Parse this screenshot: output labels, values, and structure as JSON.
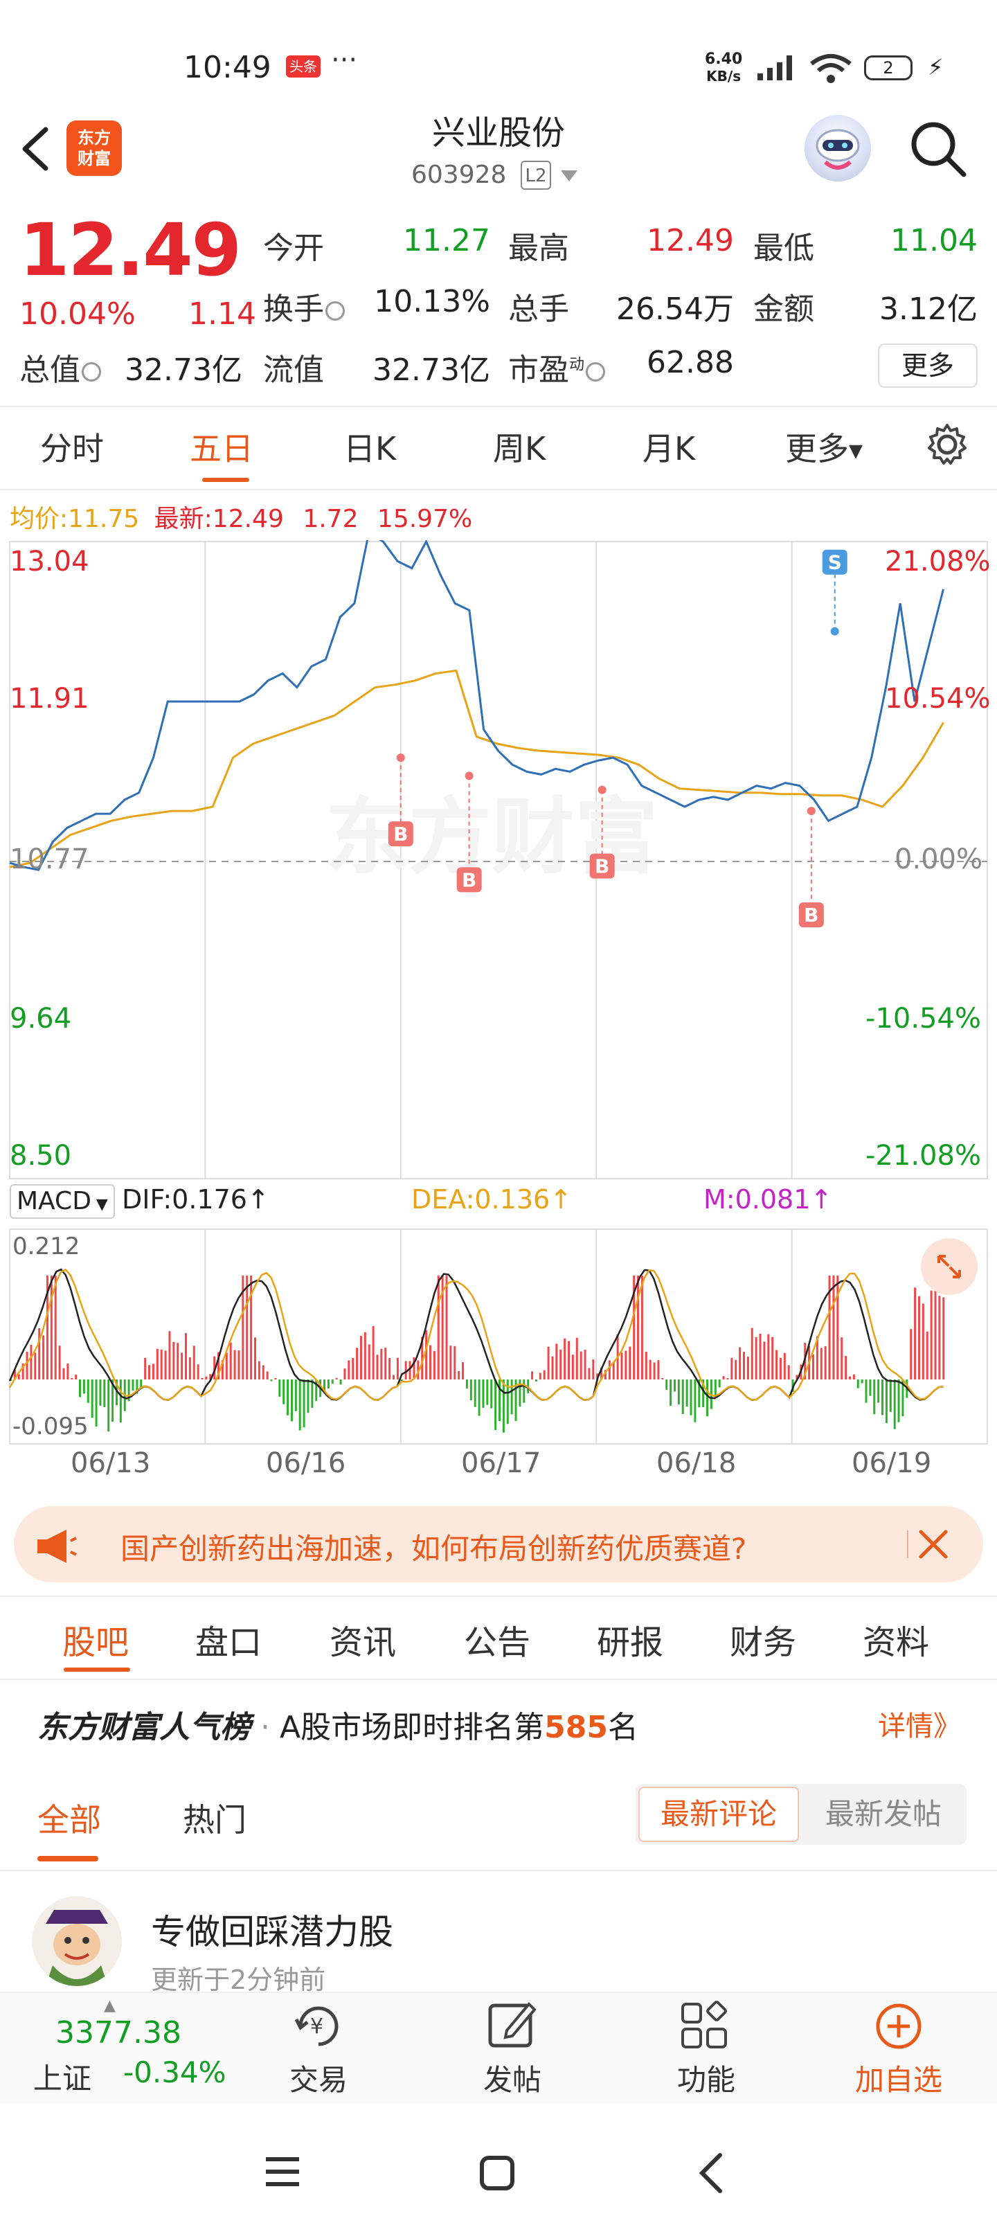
{
  "status": {
    "time": "10:49",
    "toutiao": "头条",
    "dots": "···",
    "speed_top": "6.40",
    "speed_bottom": "KB/s",
    "battery": "2"
  },
  "header": {
    "back": "back",
    "logo_line1": "东方",
    "logo_line2": "财富",
    "name": "兴业股份",
    "code": "603928",
    "level": "L2"
  },
  "quote": {
    "price": "12.49",
    "pct": "10.04%",
    "change": "1.14",
    "open_label": "今开",
    "open": "11.27",
    "high_label": "最高",
    "high": "12.49",
    "low_label": "最低",
    "low": "11.04",
    "turnover_label": "换手",
    "turnover": "10.13%",
    "volume_label": "总手",
    "volume": "26.54万",
    "amount_label": "金额",
    "amount": "3.12亿",
    "mktcap_label": "总值",
    "mktcap": "32.73亿",
    "float_label": "流值",
    "float": "32.73亿",
    "pe_label": "市盈",
    "pe_sup": "动",
    "pe": "62.88",
    "more": "更多"
  },
  "chart_tabs": [
    "分时",
    "五日",
    "日K",
    "周K",
    "月K",
    "更多"
  ],
  "avg_line": {
    "avg_label": "均价:",
    "avg": "11.75",
    "latest_label": "最新:",
    "latest": "12.49",
    "chg": "1.72",
    "pct": "15.97%"
  },
  "chart_data": {
    "type": "line",
    "title": "",
    "y_left_ticks": [
      "13.04",
      "11.91",
      "10.77",
      "9.64",
      "8.50"
    ],
    "y_right_ticks": [
      "21.08%",
      "10.54%",
      "0.00%",
      "-10.54%",
      "-21.08%"
    ],
    "ylim": [
      8.5,
      13.04
    ],
    "base_price": 10.77,
    "x_dates": [
      "06/13",
      "06/16",
      "06/17",
      "06/18",
      "06/19"
    ],
    "series": [
      {
        "name": "",
        "color": "#2f6fb5",
        "values": [
          10.75,
          10.72,
          10.7,
          10.9,
          11.0,
          11.05,
          11.1,
          11.1,
          11.2,
          11.25,
          11.5,
          11.9,
          11.9,
          11.9,
          11.9,
          11.9,
          11.9,
          11.95,
          12.05,
          12.1,
          12.0,
          12.15,
          12.2,
          12.5,
          12.6,
          13.1,
          13.04,
          12.9,
          12.85,
          13.04,
          12.8,
          12.6,
          12.55,
          11.7,
          11.55,
          11.45,
          11.4,
          11.38,
          11.42,
          11.4,
          11.45,
          11.48,
          11.5,
          11.45,
          11.3,
          11.25,
          11.2,
          11.15,
          11.2,
          11.22,
          11.2,
          11.25,
          11.3,
          11.28,
          11.32,
          11.3,
          11.2,
          11.05,
          11.1,
          11.15,
          11.5,
          12.0,
          12.6,
          11.9,
          12.3,
          12.7
        ]
      },
      {
        "name": "",
        "color": "#e8a317",
        "values": [
          10.72,
          10.75,
          10.85,
          10.95,
          11.0,
          11.05,
          11.08,
          11.1,
          11.12,
          11.12,
          11.15,
          11.5,
          11.6,
          11.65,
          11.7,
          11.75,
          11.8,
          11.9,
          12.0,
          12.02,
          12.05,
          12.1,
          12.12,
          11.65,
          11.6,
          11.57,
          11.55,
          11.54,
          11.53,
          11.52,
          11.5,
          11.45,
          11.35,
          11.28,
          11.27,
          11.26,
          11.25,
          11.25,
          11.24,
          11.24,
          11.23,
          11.23,
          11.2,
          11.15,
          11.3,
          11.5,
          11.75
        ]
      }
    ],
    "markers": [
      {
        "label": "B",
        "day": 2,
        "price": 11.5
      },
      {
        "label": "B",
        "day": 2.35,
        "price": 11.37
      },
      {
        "label": "B",
        "day": 3.03,
        "price": 11.27
      },
      {
        "label": "B",
        "day": 4.1,
        "price": 11.12
      },
      {
        "label": "S",
        "day": 4.22,
        "price": 12.4
      }
    ],
    "macd": {
      "label": "MACD",
      "dif": "DIF:0.176↑",
      "dea": "DEA:0.136↑",
      "m": "M:0.081↑",
      "ymax": "0.212",
      "ymin": "-0.095"
    }
  },
  "watermark": "东方财富",
  "banner": {
    "text": "国产创新药出海加速，如何布局创新药优质赛道?"
  },
  "news_tabs": [
    "股吧",
    "盘口",
    "资讯",
    "公告",
    "研报",
    "财务",
    "资料"
  ],
  "popular": {
    "brand": "东方财富人气榜",
    "dot": "·",
    "pre": "A股市场即时排名第",
    "rank": "585",
    "post": "名",
    "detail": "详情》"
  },
  "sub_tabs": {
    "all": "全部",
    "hot": "热门",
    "latest_comment": "最新评论",
    "latest_post": "最新发帖"
  },
  "post": {
    "title": "专做回踩潜力股",
    "time": "更新于2分钟前"
  },
  "bottom": {
    "index_value": "3377.38",
    "index_name": "上证",
    "index_pct": "-0.34%",
    "trade": "交易",
    "post": "发帖",
    "func": "功能",
    "add": "加自选"
  }
}
